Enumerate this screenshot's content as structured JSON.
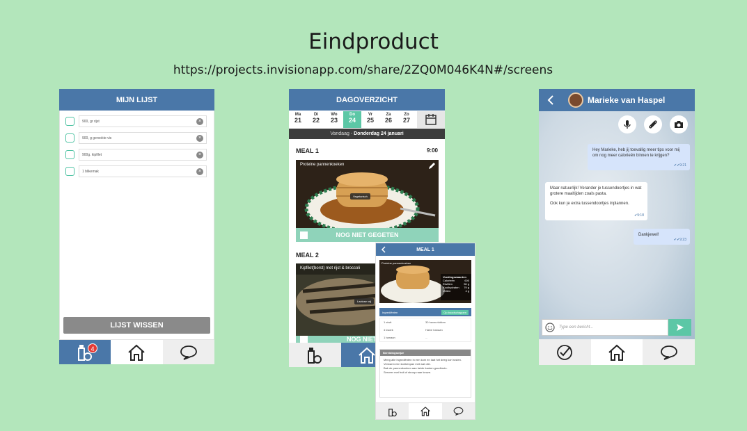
{
  "slide": {
    "title": "Eindproduct",
    "url": "https://projects.invisionapp.com/share/2ZQ0M046K4N#/screens"
  },
  "list_screen": {
    "title": "MIJN LIJST",
    "items": [
      "900, gr rijst",
      "900, g gerookte vis ",
      "900g. kipfilet",
      "1 blikemak"
    ],
    "clear_button": "LIJST WISSEN",
    "badge_count": "4"
  },
  "day_screen": {
    "title": "DAGOVERZICHT",
    "days": [
      {
        "name": "Ma",
        "num": "21"
      },
      {
        "name": "Di",
        "num": "22"
      },
      {
        "name": "Wo",
        "num": "23"
      },
      {
        "name": "Do",
        "num": "24"
      },
      {
        "name": "Vr",
        "num": "25"
      },
      {
        "name": "Za",
        "num": "26"
      },
      {
        "name": "Zo",
        "num": "27"
      }
    ],
    "date_prefix": "Vandaag - ",
    "date_bold": "Donderdag 24 januari",
    "meal1": {
      "label": "MEAL 1",
      "time": "9:00",
      "caption": "Proteine pannenkoeken",
      "tag": "Vegetarisch"
    },
    "meal2": {
      "label": "MEAL 2",
      "caption": "Kipfilet(borst) met rijst & broccoli",
      "tag": "Lactose vrij"
    },
    "not_eaten": "NOG NIET GEGETEN",
    "not_eaten_partial": "NOG NIET GE"
  },
  "chat_screen": {
    "contact": "Marieke van Haspel",
    "messages": [
      {
        "dir": "out",
        "text": "Hey Marieke, heb jij toevallig meer tips voor mij om nog meer calorieën binnen te krijgen?",
        "time": "9:21"
      },
      {
        "dir": "in",
        "text1": "Maar natuurlijk! Verander je tussendoortjes in wat grotere maaltijden zoals pasta.",
        "text2": "Ook kun je extra tussendoortjes inplannen.",
        "time": "9:18"
      },
      {
        "dir": "out",
        "text": "Dankjewel!",
        "time": "9:23"
      }
    ],
    "input_placeholder": "Type een bericht..."
  },
  "meal_detail": {
    "title": "MEAL 1",
    "caption": "Proteine pannenkoeken",
    "nutrition_title": "Voedingswaarden",
    "nutrition": [
      {
        "k": "Calorieën",
        "v": "600"
      },
      {
        "k": "Eiwitten",
        "v": "56 g"
      },
      {
        "k": "Koolhydraten",
        "v": "79 g"
      },
      {
        "k": "Vetten",
        "v": "4 g"
      }
    ],
    "ingredients_title": "Ingrediënten",
    "ingredients_btn": "Op boodschappen",
    "ingredients": [
      "1 eiwit",
      "30 havervlokken",
      "4 kwark",
      "Halve banaan",
      "1 banaan",
      "..."
    ],
    "prep_title": "Bereidingswijze",
    "prep_lines": [
      "Meng alle ingrediënten in een kom en laat het deeg kort rusten.",
      "Verwarm een koekenpan met wat olie.",
      "Bak de pannenkoeken aan beide kanten goudbruin.",
      "Serveer met fruit of stroop naar keuze."
    ]
  },
  "colors": {
    "header": "#4a77a8",
    "accent": "#5cc7a6",
    "background": "#b3e6bb"
  },
  "icons": [
    "bottle-apple-icon",
    "home-icon",
    "chat-icon",
    "calendar-icon",
    "mic-icon",
    "paperclip-icon",
    "camera-icon",
    "send-icon",
    "emoji-icon",
    "back-arrow-icon",
    "checkmark-icon",
    "pencil-icon"
  ]
}
